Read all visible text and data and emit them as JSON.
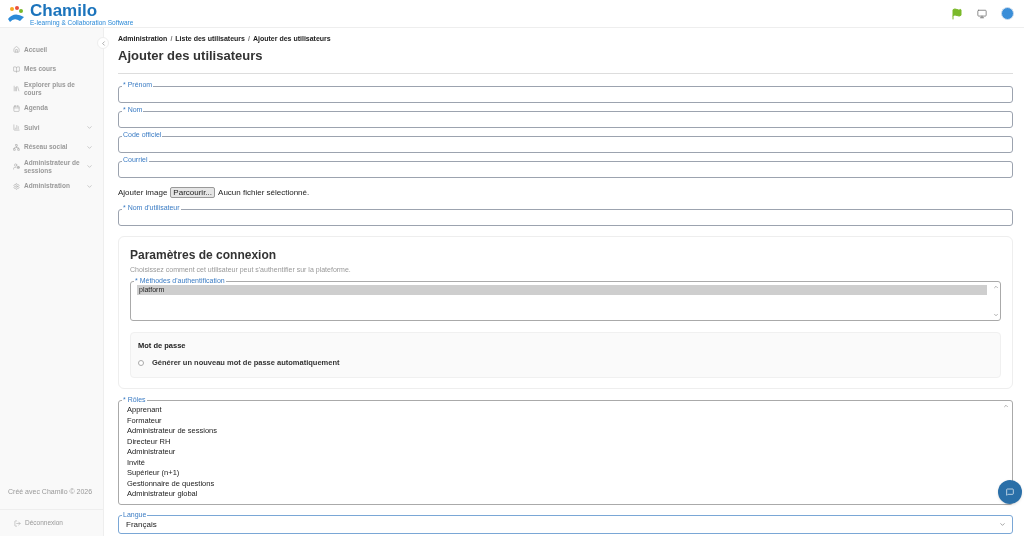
{
  "header": {
    "logo": "Chamilo",
    "tagline": "E-learning & Collaboration Software"
  },
  "sidebar": {
    "items": [
      {
        "label": "Accueil",
        "expandable": false
      },
      {
        "label": "Mes cours",
        "expandable": false
      },
      {
        "label": "Explorer plus de cours",
        "expandable": false
      },
      {
        "label": "Agenda",
        "expandable": false
      },
      {
        "label": "Suivi",
        "expandable": true
      },
      {
        "label": "Réseau social",
        "expandable": true
      },
      {
        "label": "Administrateur de sessions",
        "expandable": true
      },
      {
        "label": "Administration",
        "expandable": true
      }
    ],
    "footer": "Créé avec Chamilo © 2026",
    "logout": "Déconnexion"
  },
  "breadcrumb": {
    "separator": "/",
    "items": [
      "Administration",
      "Liste des utilisateurs",
      "Ajouter des utilisateurs"
    ]
  },
  "title": "Ajouter des utilisateurs",
  "fields": [
    {
      "label": "* Prénom"
    },
    {
      "label": "* Nom"
    },
    {
      "label": "Code officiel"
    },
    {
      "label": "Courriel"
    }
  ],
  "image_upload": {
    "label": "Ajouter image",
    "button": "Parcourir...",
    "status": "Aucun fichier sélectionné."
  },
  "username": {
    "label": "* Nom d'utilisateur"
  },
  "connection": {
    "title": "Paramètres de connexion",
    "description": "Choisissez comment cet utilisateur peut s'authentifier sur la plateforme.",
    "auth": {
      "label": "* Méthodes d'authentification",
      "options": [
        {
          "label": "platform",
          "selected": true
        }
      ]
    },
    "password": {
      "title": "Mot de passe",
      "options": [
        {
          "label": "Générer un nouveau mot de passe automatiquement",
          "selected": false
        }
      ]
    }
  },
  "roles": {
    "label": "* Rôles",
    "options": [
      {
        "label": "Apprenant",
        "selected": false
      },
      {
        "label": "Formateur",
        "selected": false
      },
      {
        "label": "Administrateur de sessions",
        "selected": false
      },
      {
        "label": "Directeur RH",
        "selected": false
      },
      {
        "label": "Administrateur",
        "selected": false
      },
      {
        "label": "Invité",
        "selected": false
      },
      {
        "label": "Supérieur (n+1)",
        "selected": false
      },
      {
        "label": "Gestionnaire de questions",
        "selected": false
      },
      {
        "label": "Administrateur global",
        "selected": false
      }
    ]
  },
  "language": {
    "label": "Langue",
    "value": "Français"
  }
}
